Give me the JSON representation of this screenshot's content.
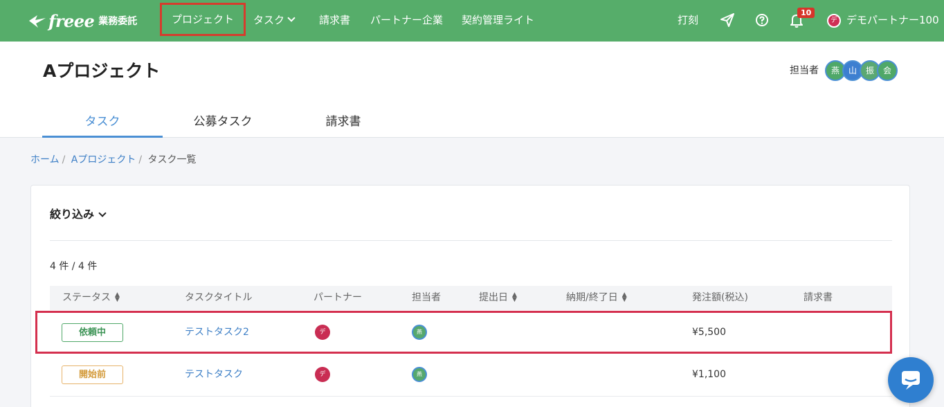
{
  "nav": {
    "logo_mark": "freee",
    "logo_sub": "業務委託",
    "items": [
      {
        "label": "プロジェクト"
      },
      {
        "label": "タスク"
      },
      {
        "label": "請求書"
      },
      {
        "label": "パートナー企業"
      },
      {
        "label": "契約管理ライト"
      }
    ],
    "clock_in": "打刻",
    "notification_count": "10",
    "user_initial": "デ",
    "user_name": "デモパートナー100"
  },
  "project": {
    "title": "Aプロジェクト",
    "assignee_label": "担当者",
    "assignees": [
      "燕",
      "山",
      "振",
      "会"
    ],
    "tabs": [
      {
        "label": "タスク"
      },
      {
        "label": "公募タスク"
      },
      {
        "label": "請求書"
      }
    ]
  },
  "breadcrumb": {
    "items": [
      "ホーム",
      "Aプロジェクト",
      "タスク一覧"
    ],
    "separator": "/"
  },
  "filter": {
    "label": "絞り込み",
    "count": "4 件 / 4 件"
  },
  "table": {
    "headers": [
      "ステータス",
      "タスクタイトル",
      "パートナー",
      "担当者",
      "提出日",
      "納期/終了日",
      "発注額(税込)",
      "請求書"
    ],
    "rows": [
      {
        "status": "依頼中",
        "title": "テストタスク2",
        "partner": "デ",
        "assignee": "燕",
        "amount": "¥5,500"
      },
      {
        "status": "開始前",
        "title": "テストタスク",
        "partner": "デ",
        "assignee": "燕",
        "amount": "¥1,100"
      }
    ]
  },
  "colors": {
    "nav_bg": "#56ad6a",
    "accent_blue": "#4a8fd4",
    "highlight_red": "#d63c2d",
    "row_highlight": "#d42f4e"
  }
}
